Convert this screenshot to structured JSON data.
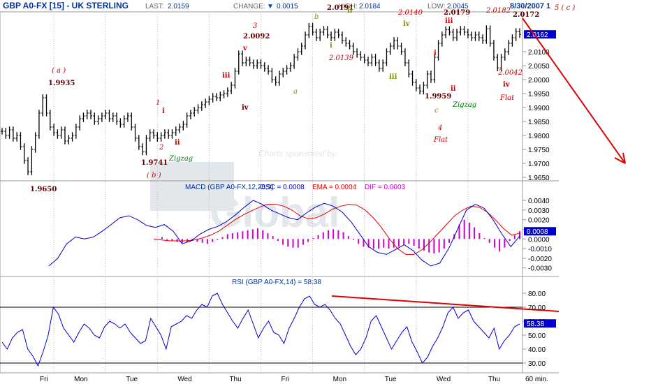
{
  "header": {
    "symbol": "GBP A0-FX [15] - UK STERLING",
    "last_label": "LAST:",
    "last_value": "2.0159",
    "change_label": "CHANGE:",
    "change_arrow": "▼",
    "change_value": "0.0015",
    "high_label": "HIGH:",
    "high_value": "2.0184",
    "low_label": "LOW:",
    "low_value": "2.0045",
    "date": "8/30/2007 1"
  },
  "colors": {
    "price": "#000000",
    "macd": "#0000cc",
    "ema": "#dd0000",
    "osc": "#cc00cc",
    "rsi": "#0000cc",
    "trend": "#dd0000",
    "wave_red": "#cc0000",
    "wave_dark": "#660000",
    "wave_olive": "#888800",
    "wave_green": "#007700",
    "grid": "#b8b8b8",
    "axis_badge": "#0000cc"
  },
  "watermark": {
    "sponsor": "Charts sponsored by:",
    "brand": "Global"
  },
  "x_labels": [
    "Fri",
    "Mon",
    "Tue",
    "Wed",
    "Thu",
    "Fri",
    "Mon",
    "Tue",
    "Wed",
    "Thu"
  ],
  "x_unit": "60 min.",
  "chart_data": [
    {
      "type": "line",
      "title": "GBP A0-FX [15] - UK STERLING",
      "ylim": [
        1.965,
        2.023
      ],
      "y_ticks": [
        "2.0100",
        "2.0050",
        "2.0000",
        "1.9950",
        "1.9900",
        "1.9850",
        "1.9800",
        "1.9750",
        "1.9700",
        "1.9650"
      ],
      "y_tick_values": [
        2.01,
        2.005,
        2.0,
        1.995,
        1.99,
        1.985,
        1.98,
        1.975,
        1.97,
        1.965
      ],
      "last_badge": "2.0162",
      "last_value": 2.0162,
      "series": [
        {
          "values": [
            1.9815,
            1.98,
            1.982,
            1.979,
            1.98,
            1.976,
            1.971,
            1.967,
            1.975,
            1.98,
            1.988,
            1.9935,
            1.988,
            1.983,
            1.981,
            1.98,
            1.982,
            1.978,
            1.979,
            1.98,
            1.983,
            1.986,
            1.987,
            1.988,
            1.987,
            1.985,
            1.986,
            1.987,
            1.988,
            1.986,
            1.987,
            1.985,
            1.984,
            1.986,
            1.987,
            1.983,
            1.979,
            1.976,
            1.9741,
            1.979,
            1.981,
            1.98,
            1.979,
            1.98,
            1.981,
            1.98,
            1.981,
            1.982,
            1.983,
            1.984,
            1.987,
            1.988,
            1.989,
            1.99,
            1.991,
            1.992,
            1.993,
            1.994,
            1.9935,
            1.9945,
            1.995,
            1.996,
            1.998,
            2.003,
            2.0092,
            2.006,
            2.007,
            2.006,
            2.005,
            2.006,
            2.005,
            2.004,
            2.003,
            2.0,
            1.999,
            2.002,
            2.003,
            2.004,
            2.005,
            2.008,
            2.01,
            2.012,
            2.016,
            2.0191,
            2.017,
            2.015,
            2.017,
            2.018,
            2.016,
            2.015,
            2.017,
            2.016,
            2.014,
            2.013,
            2.012,
            2.01,
            2.009,
            2.008,
            2.007,
            2.006,
            2.008,
            2.006,
            2.004,
            2.006,
            2.01,
            2.012,
            2.014,
            2.012,
            2.01,
            2.006,
            2.002,
            1.999,
            1.997,
            1.9959,
            1.998,
            2.002,
            2.0,
            2.008,
            2.013,
            2.016,
            2.0179,
            2.017,
            2.015,
            2.017,
            2.018,
            2.017,
            2.016,
            2.015,
            2.016,
            2.015,
            2.014,
            2.0182,
            2.013,
            2.008,
            2.0042,
            2.008,
            2.01,
            2.013,
            2.015,
            2.0172,
            2.0162
          ]
        }
      ]
    },
    {
      "type": "line",
      "title": "MACD (GBP A0-FX,12,26,9)",
      "ylim": [
        -0.0036,
        0.0048
      ],
      "y_ticks": [
        "0.0040",
        "0.0030",
        "0.0020",
        "0.0010",
        "0.0000",
        "-0.0010",
        "-0.0020",
        "-0.0030"
      ],
      "y_tick_values": [
        0.004,
        0.003,
        0.002,
        0.001,
        0.0,
        -0.001,
        -0.002,
        -0.003
      ],
      "last_badge": "0.0008",
      "last_value": 0.0008,
      "series": [
        {
          "name": "OSC = 0.0008",
          "values": [
            0.0002,
            -0.0001,
            -0.0002,
            -0.0003,
            -0.0004,
            -0.0003,
            -0.0002,
            -0.0003,
            -0.0004,
            -0.0005,
            -0.0003,
            -0.0001,
            0.0002,
            0.0005,
            0.0006,
            0.0007,
            0.0008,
            0.0009,
            0.001,
            0.0011,
            0.0009,
            0.0006,
            0.0003,
            -0.0002,
            -0.0006,
            -0.0008,
            -0.0009,
            -0.0009,
            -0.0006,
            -0.0003,
            0.0001,
            0.0004,
            0.0007,
            0.0009,
            0.001,
            0.0009,
            0.0007,
            0.0003,
            -0.0001,
            -0.0005,
            -0.0008,
            -0.0009,
            -0.001,
            -0.001,
            -0.0009,
            -0.001,
            -0.0009,
            -0.0008,
            -0.0006,
            -0.0005,
            -0.0007,
            -0.001,
            -0.0012,
            -0.0014,
            -0.0015,
            -0.0014,
            -0.001,
            -0.0004,
            0.0005,
            0.0015,
            0.002,
            0.0017,
            0.0012,
            0.0006,
            0.0001,
            -0.0004,
            -0.0009,
            -0.0013,
            -0.0009,
            -0.0002,
            0.0004,
            0.0008
          ]
        },
        {
          "name": "EMA = 0.0004",
          "values": [
            0.0,
            -0.0001,
            -0.0002,
            -0.0002,
            -0.0002,
            -0.0001,
            0.0001,
            0.0004,
            0.0008,
            0.0014,
            0.002,
            0.0025,
            0.0029,
            0.0033,
            0.0036,
            0.0036,
            0.0034,
            0.003,
            0.0024,
            0.0021,
            0.0022,
            0.0026,
            0.0031,
            0.0034,
            0.0036,
            0.0035,
            0.003,
            0.0022,
            0.0012,
            0.0,
            -0.001,
            -0.0016,
            -0.0016,
            -0.0011,
            -0.0003,
            0.0006,
            0.0015,
            0.0024,
            0.003,
            0.0034,
            0.0033,
            0.0028,
            0.002,
            0.0011,
            0.0004,
            0.0006
          ]
        },
        {
          "name": "DIF = 0.0003",
          "values": [
            -0.0028,
            -0.002,
            -0.0005,
            0.0002,
            0.0,
            0.0002,
            0.0008,
            0.0015,
            0.0022,
            0.0024,
            0.002,
            0.0014,
            0.0012,
            0.0015,
            0.0008,
            -0.0005,
            -0.0002,
            0.0005,
            0.001,
            0.0013,
            0.0018,
            0.0025,
            0.0033,
            0.004,
            0.0036,
            0.003,
            0.0026,
            0.0022,
            0.002,
            0.0027,
            0.0033,
            0.0037,
            0.0034,
            0.0028,
            0.0018,
            0.0005,
            -0.0008,
            -0.0014,
            -0.0016,
            -0.0011,
            -0.0006,
            -0.0012,
            -0.0022,
            -0.0028,
            -0.0025,
            -0.001,
            0.001,
            0.003,
            0.0036,
            0.0032,
            0.002,
            0.0005,
            -0.0008,
            0.0003
          ]
        }
      ]
    },
    {
      "type": "line",
      "title": "RSI (GBP A0-FX,14) = 58.38",
      "ylim": [
        25,
        85
      ],
      "y_ticks": [
        "80.00",
        "70.00",
        "60.00",
        "50.00",
        "40.00",
        "30.00"
      ],
      "y_tick_values": [
        80,
        70,
        60,
        50,
        40,
        30
      ],
      "reference_lines": [
        70,
        30
      ],
      "last_badge": "58.38",
      "last_value": 58.38,
      "series": [
        {
          "values": [
            45,
            40,
            48,
            52,
            54,
            40,
            35,
            28,
            38,
            50,
            70,
            65,
            55,
            50,
            45,
            52,
            58,
            55,
            50,
            48,
            56,
            60,
            58,
            55,
            58,
            52,
            48,
            44,
            46,
            62,
            56,
            50,
            40,
            56,
            58,
            60,
            64,
            62,
            68,
            72,
            70,
            78,
            80,
            72,
            66,
            60,
            55,
            62,
            68,
            58,
            48,
            55,
            60,
            52,
            50,
            44,
            55,
            62,
            70,
            76,
            78,
            72,
            70,
            72,
            68,
            62,
            58,
            50,
            42,
            36,
            40,
            48,
            60,
            64,
            56,
            48,
            40,
            46,
            52,
            56,
            45,
            38,
            30,
            34,
            42,
            48,
            56,
            66,
            70,
            62,
            66,
            68,
            60,
            56,
            52,
            48,
            55,
            40,
            46,
            50,
            56,
            58
          ]
        }
      ],
      "trendline": [
        78,
        67
      ]
    }
  ],
  "annotations": {
    "w_a_label": "( a )",
    "w_a_price": "1.9935",
    "w_1": "1",
    "w_i1": "i",
    "w_2": "2",
    "w_ii1": "ii",
    "w_b_price": "1.9741",
    "w_b_label": "( b )",
    "w_zigzag1": "Zigzag",
    "w_low_price": "1.9650",
    "w_iii1": "iii",
    "w_iv1": "iv",
    "w_3": "3",
    "w_3_price": "2.0092",
    "w_v1": "v",
    "w_a2": "a",
    "w_b2": "b",
    "w_top_price": "2.0191",
    "w_ii2": "ii",
    "w_i2": "i",
    "w_i2_price": "2.0139",
    "w_2140": "2.0140",
    "w_iv2": "iv",
    "w_iii2": "iii",
    "w_1959": "1.9959",
    "w_c": "c",
    "w_4": "4",
    "w_flat1": "Flat",
    "w_i3": "i",
    "w_ii3": "ii",
    "w_zigzag2": "Zigzag",
    "w_iii3": "iii",
    "w_2179": "2.0179",
    "w_2182": "2.0182",
    "w_2042": "2.0042",
    "w_iv3": "iv",
    "w_flat2": "Flat",
    "w_2172": "2.0172",
    "w_5c": "5 ( c )"
  }
}
